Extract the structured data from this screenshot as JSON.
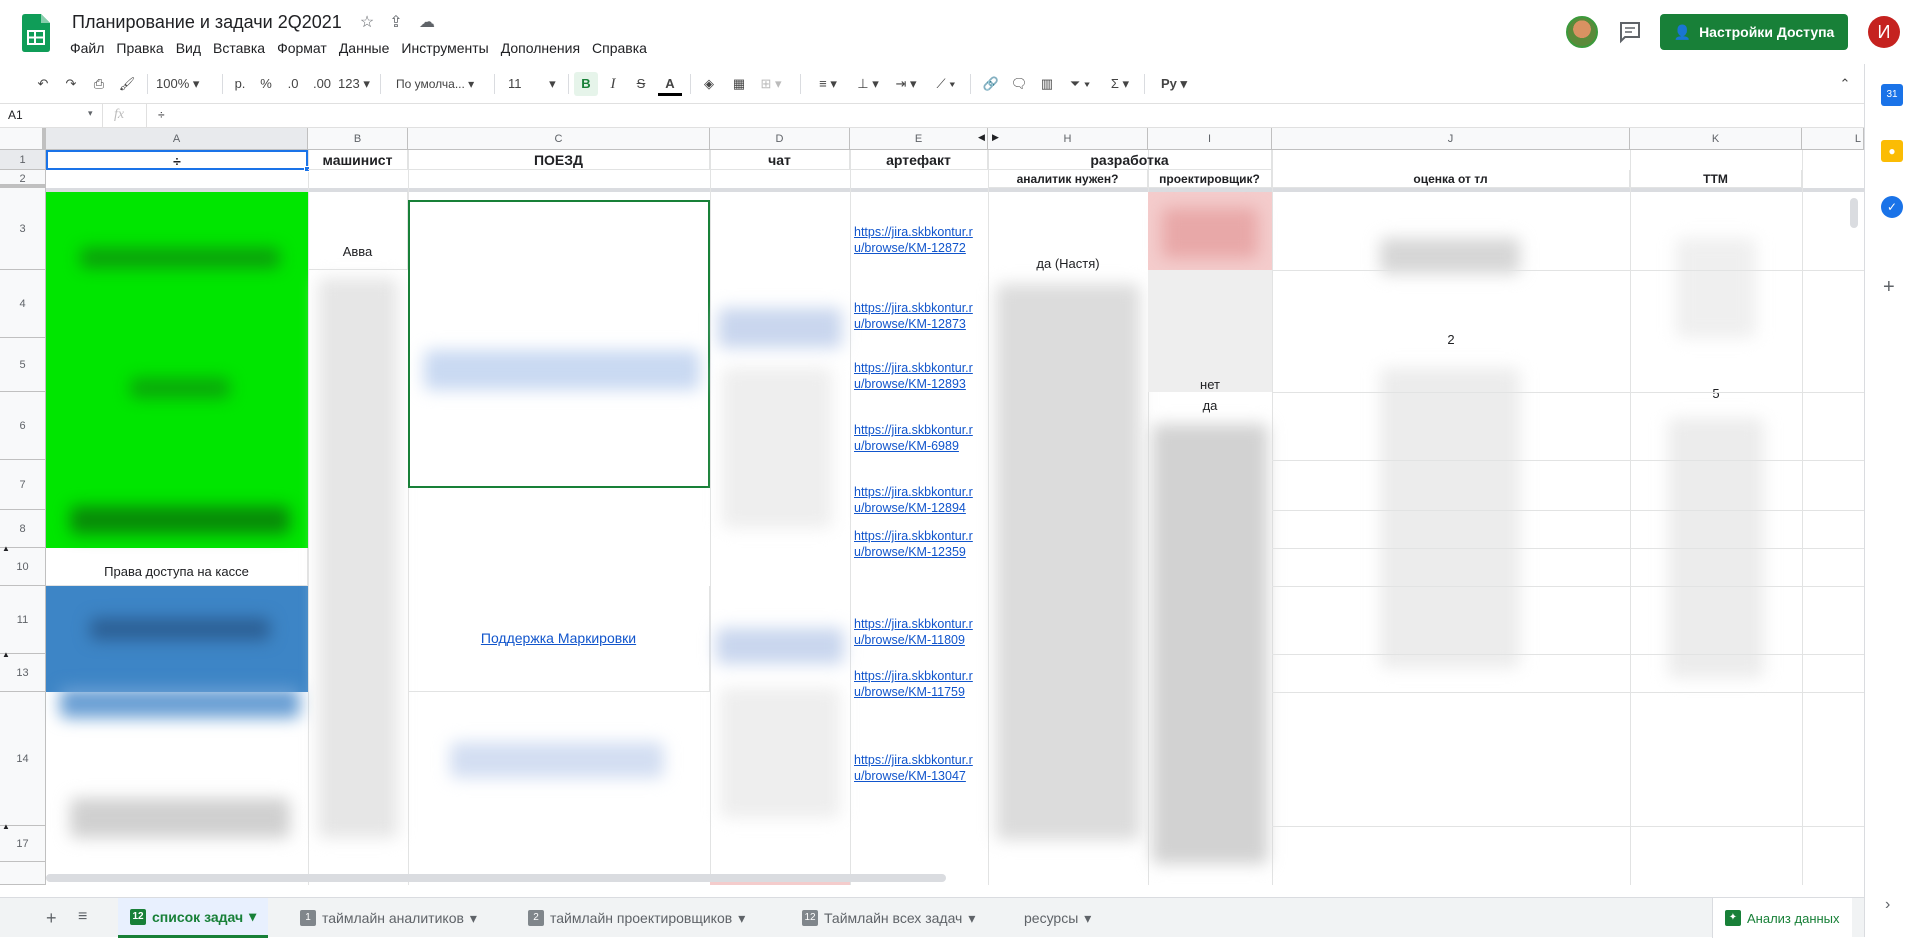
{
  "doc": {
    "title": "Планирование и задачи 2Q2021",
    "menu": [
      "Файл",
      "Правка",
      "Вид",
      "Вставка",
      "Формат",
      "Данные",
      "Инструменты",
      "Дополнения",
      "Справка"
    ],
    "share_label": "Настройки Доступа",
    "user_initial": "И"
  },
  "toolbar": {
    "zoom": "100%",
    "currency": "р.",
    "percent": "%",
    "dec_less": ".0",
    "dec_more": ".00",
    "format_more": "123",
    "font": "По умолча...",
    "font_size": "11",
    "bold": "B",
    "italic": "I",
    "strike": "S",
    "text_color": "A",
    "input_tools": "Py"
  },
  "formula": {
    "cell_ref": "A1",
    "fx": "fx",
    "value": "÷"
  },
  "columns": [
    "A",
    "B",
    "C",
    "D",
    "E",
    "H",
    "I",
    "J",
    "K",
    "L"
  ],
  "rows": [
    "1",
    "2",
    "3",
    "4",
    "5",
    "6",
    "7",
    "8",
    "10",
    "11",
    "13",
    "14",
    "17"
  ],
  "cells": {
    "a1": "÷",
    "b1": "машинист",
    "c1": "ПОЕЗД",
    "d1": "чат",
    "e1": "артефакт",
    "h1": "разработка",
    "h2": "аналитик нужен?",
    "i2": "проектировщик?",
    "j2": "оценка от тл",
    "k2": "TTM",
    "b3": "Авва",
    "h3": "да (Настя)",
    "j4": "2",
    "i5": "нет",
    "k5": "5",
    "i6": "да",
    "a10": "Права доступа на кассе",
    "c11": "Поддержка Маркировки"
  },
  "links": [
    {
      "row": "3",
      "line1": "https://jira.skbkontur.r",
      "line2": "u/browse/KM-12872"
    },
    {
      "row": "4",
      "line1": "https://jira.skbkontur.r",
      "line2": "u/browse/KM-12873"
    },
    {
      "row": "5",
      "line1": "https://jira.skbkontur.r",
      "line2": "u/browse/KM-12893"
    },
    {
      "row": "6",
      "line1": "https://jira.skbkontur.r",
      "line2": "u/browse/KM-6989"
    },
    {
      "row": "7",
      "line1": "https://jira.skbkontur.r",
      "line2": "u/browse/KM-12894"
    },
    {
      "row": "8",
      "line1": "https://jira.skbkontur.r",
      "line2": "u/browse/KM-12359"
    },
    {
      "row": "11",
      "line1": "https://jira.skbkontur.r",
      "line2": "u/browse/KM-11809"
    },
    {
      "row": "13",
      "line1": "https://jira.skbkontur.r",
      "line2": "u/browse/KM-11759"
    },
    {
      "row": "14",
      "line1": "https://jira.skbkontur.r",
      "line2": "u/browse/KM-13047"
    }
  ],
  "tabs": {
    "active": {
      "badge": "12",
      "label": "список задач"
    },
    "t2": {
      "badge": "1",
      "label": "таймлайн аналитиков"
    },
    "t3": {
      "badge": "2",
      "label": "таймлайн проектировщиков"
    },
    "t4": {
      "badge": "12",
      "label": "Таймлайн всех задач"
    },
    "t5": {
      "label": "ресурсы"
    },
    "explore": "Анализ данных"
  },
  "colors": {
    "brand_green": "#188038",
    "cell_green": "#00e600",
    "cell_blue": "#3d85c6",
    "link": "#1155cc",
    "avatar_red": "#c5221f"
  }
}
